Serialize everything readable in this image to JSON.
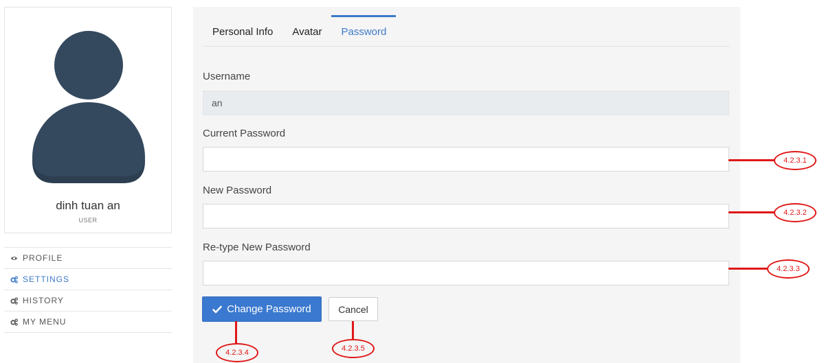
{
  "profile": {
    "name": "dinh tuan an",
    "role": "USER"
  },
  "sidebar": {
    "items": [
      {
        "label": "PROFILE",
        "icon": "eye-icon",
        "active": false
      },
      {
        "label": "SETTINGS",
        "icon": "gears-icon",
        "active": true
      },
      {
        "label": "HISTORY",
        "icon": "gears-icon",
        "active": false
      },
      {
        "label": "MY MENU",
        "icon": "gears-icon",
        "active": false
      }
    ]
  },
  "tabs": [
    {
      "label": "Personal Info",
      "active": false
    },
    {
      "label": "Avatar",
      "active": false
    },
    {
      "label": "Password",
      "active": true
    }
  ],
  "form": {
    "username_label": "Username",
    "username_value": "an",
    "current_password_label": "Current Password",
    "current_password_value": "",
    "new_password_label": "New Password",
    "new_password_value": "",
    "retype_password_label": "Re-type New Password",
    "retype_password_value": ""
  },
  "actions": {
    "change_password_label": "Change Password",
    "cancel_label": "Cancel"
  },
  "annotations": {
    "current_password": "4.2.3.1",
    "new_password": "4.2.3.2",
    "retype_password": "4.2.3.3",
    "change_password": "4.2.3.4",
    "cancel": "4.2.3.5"
  },
  "colors": {
    "accent": "#3d79c9",
    "primary_button": "#3a79cf",
    "annotation": "#e01717",
    "avatar": "#34495e"
  }
}
